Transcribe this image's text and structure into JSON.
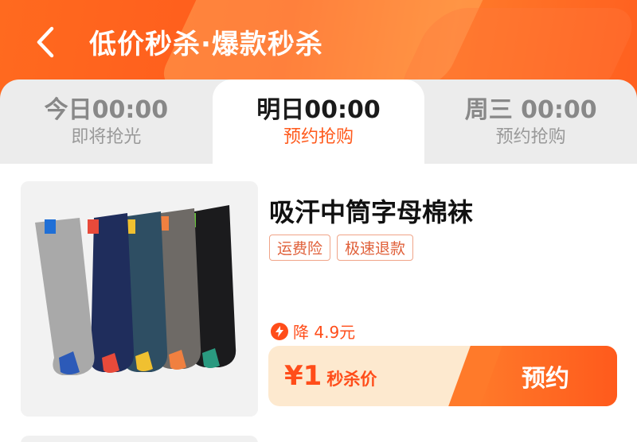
{
  "header": {
    "title": "低价秒杀·爆款秒杀",
    "back_icon": "chevron-left-icon",
    "brand_color": "#ff5a1c"
  },
  "tabs": [
    {
      "time": "今日00:00",
      "sub": "即将抢光",
      "active": false
    },
    {
      "time": "明日00:00",
      "sub": "预约抢购",
      "active": true
    },
    {
      "time": "周三 00:00",
      "sub": "预约抢购",
      "active": false
    }
  ],
  "product": {
    "title": "吸汗中筒字母棉袜",
    "badges": [
      "运费险",
      "极速退款"
    ],
    "discount_text": "降 4.9元",
    "discount_icon": "lightning-icon",
    "price": "¥1",
    "price_label": "秒杀价",
    "reserve_label": "预约",
    "image_desc": "socks-image"
  },
  "colors": {
    "accent": "#ff5a1c",
    "price_bg": "#fde9cf",
    "badge_border": "#f0a488"
  }
}
